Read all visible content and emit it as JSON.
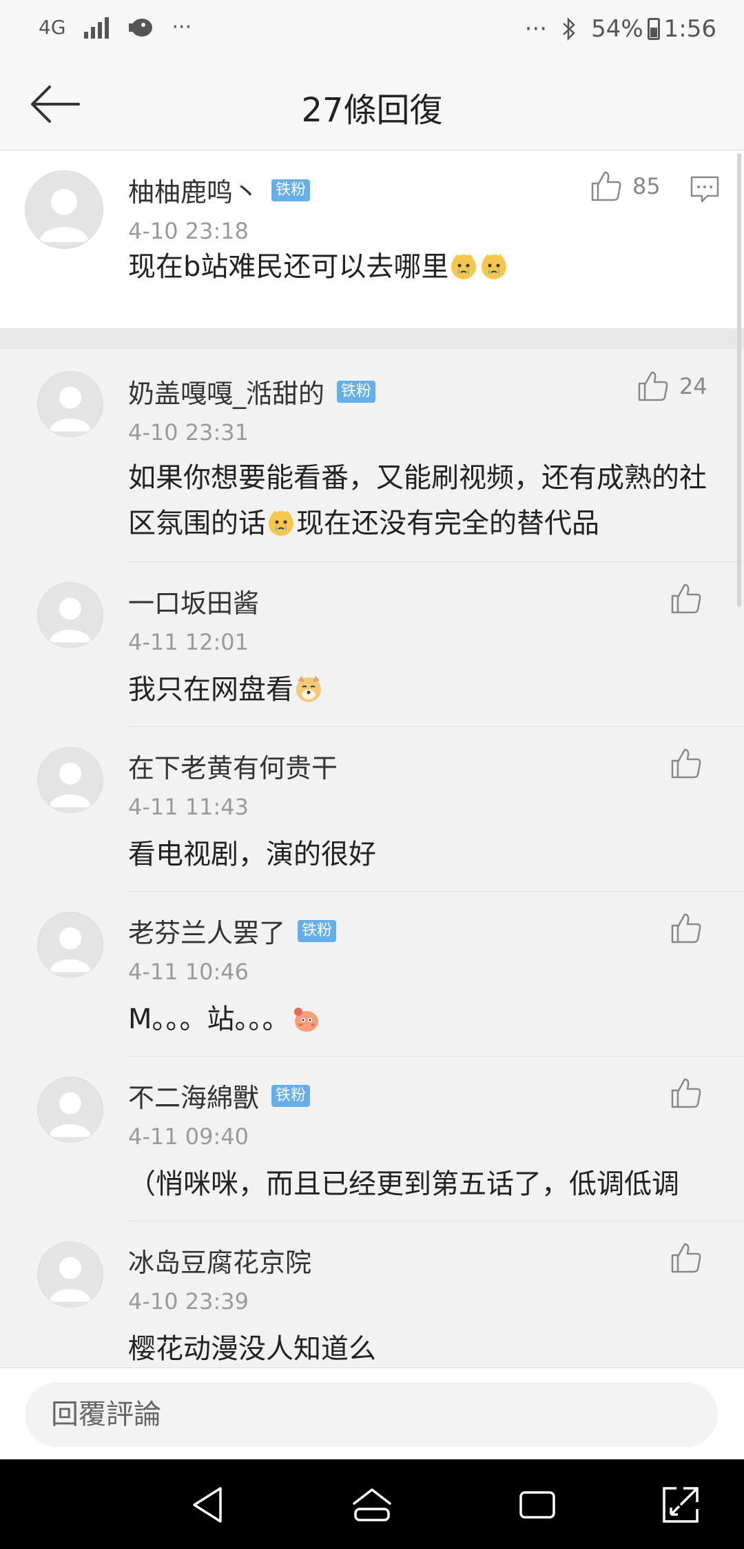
{
  "status_bar": {
    "network": "4G",
    "more_left": "···",
    "more_right": "···",
    "battery": "54%",
    "time": "1:56"
  },
  "header": {
    "title": "27條回復"
  },
  "top_comment": {
    "username": "柚柚鹿鸣丶",
    "badge": "铁粉",
    "time": "4-10 23:18",
    "content": "现在b站难民还可以去哪里",
    "likes": "85"
  },
  "replies": [
    {
      "username": "奶盖嘎嘎_湉甜的",
      "badge": "铁粉",
      "time": "4-10 23:31",
      "content_before": "如果你想要能看番，又能刷视频，还有成熟的社区氛围的话",
      "content_after": "现在还没有完全的替代品",
      "likes": "24"
    },
    {
      "username": "一口坂田酱",
      "badge": "",
      "time": "4-11 12:01",
      "content_before": "我只在网盘看",
      "content_after": "",
      "likes": ""
    },
    {
      "username": "在下老黄有何贵干",
      "badge": "",
      "time": "4-11 11:43",
      "content_before": "看电视剧，演的很好",
      "content_after": "",
      "likes": ""
    },
    {
      "username": "老芬兰人罢了",
      "badge": "铁粉",
      "time": "4-11 10:46",
      "content_before": "M。。。站。。。",
      "content_after": "",
      "likes": ""
    },
    {
      "username": "不二海綿獸",
      "badge": "铁粉",
      "time": "4-11 09:40",
      "content_before": "（悄咪咪，而且已经更到第五话了，低调低调",
      "content_after": "",
      "likes": ""
    },
    {
      "username": "冰岛豆腐花京院",
      "badge": "",
      "time": "4-10 23:39",
      "content_before": "樱花动漫没人知道么",
      "content_after": "",
      "likes": ""
    }
  ],
  "reply_input": {
    "placeholder": "回覆評論"
  }
}
